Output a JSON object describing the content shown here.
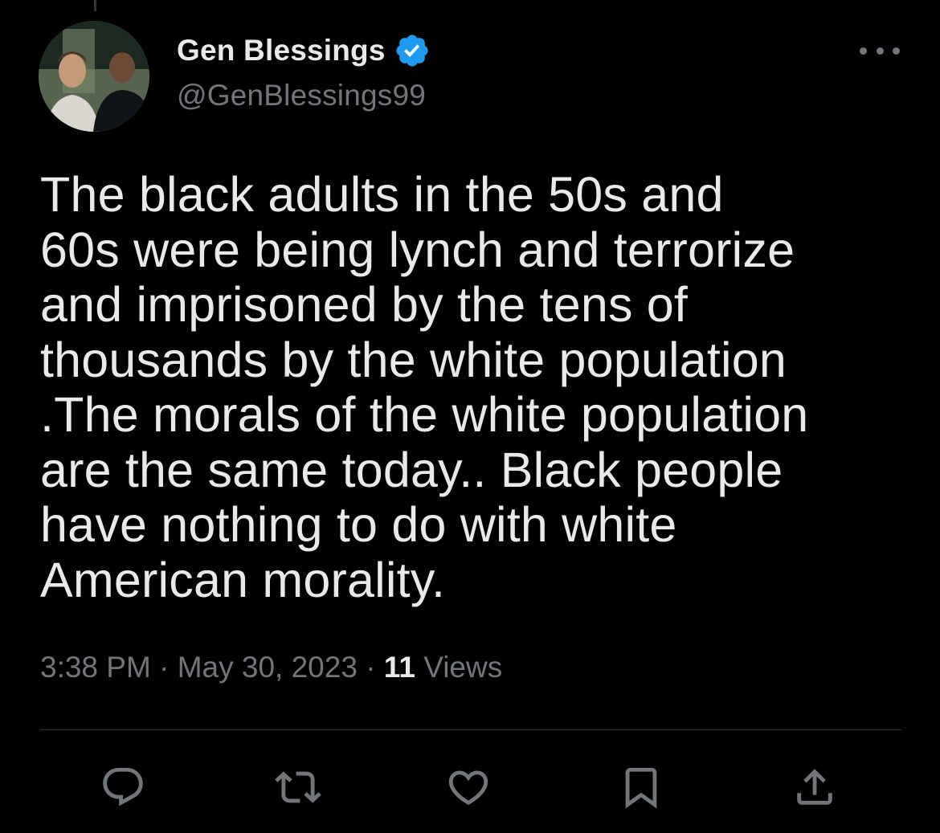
{
  "author": {
    "name": "Gen Blessings",
    "handle": "@GenBlessings99",
    "verified": true,
    "verified_color": "#1d9bf0"
  },
  "tweet": {
    "lines": [
      "The black adults in the 50s and",
      "60s were being lynch and terrorize",
      "and imprisoned by the tens of",
      "thousands by the white population",
      ".The morals of the white population",
      "are the same today.. Black people",
      "have nothing to do with white",
      "American morality."
    ],
    "time": "3:38 PM",
    "separator": "·",
    "date": "May 30, 2023",
    "views_count": "11",
    "views_label": "Views"
  },
  "actions": [
    {
      "icon": "reply-icon"
    },
    {
      "icon": "retweet-icon"
    },
    {
      "icon": "like-icon"
    },
    {
      "icon": "bookmark-icon"
    },
    {
      "icon": "share-icon"
    }
  ],
  "colors": {
    "background": "#000000",
    "text_primary": "#e7e9ea",
    "text_secondary": "#71767b",
    "divider": "#2f3336"
  }
}
